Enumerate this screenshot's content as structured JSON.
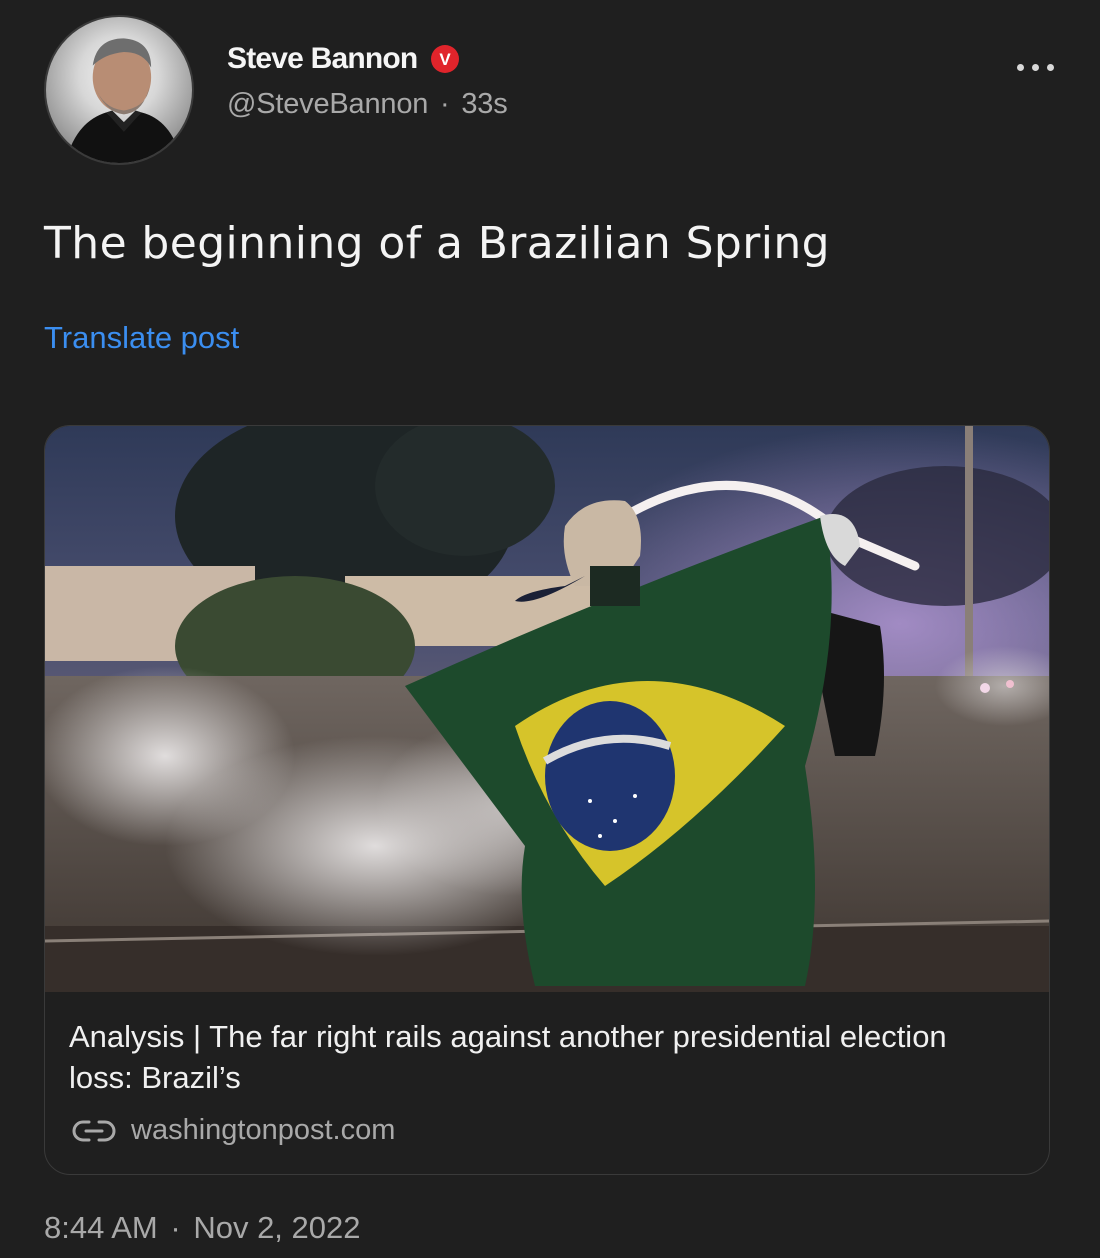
{
  "author": {
    "display_name": "Steve Bannon",
    "handle": "@SteveBannon",
    "separator": "·",
    "time_ago": "33s",
    "badge_letter": "V",
    "badge_color": "#e0242b"
  },
  "post": {
    "text": "The beginning of a Brazilian Spring",
    "translate_label": "Translate post"
  },
  "link_card": {
    "title": "Analysis | The far right rails against another presidential election loss: Brazil’s",
    "domain": "washingtonpost.com"
  },
  "footer": {
    "time": "8:44 AM",
    "separator": "·",
    "date": "Nov 2, 2022"
  },
  "colors": {
    "background": "#1f1f1f",
    "link_blue": "#3b8ef0",
    "secondary_text": "#a9a9a9"
  }
}
